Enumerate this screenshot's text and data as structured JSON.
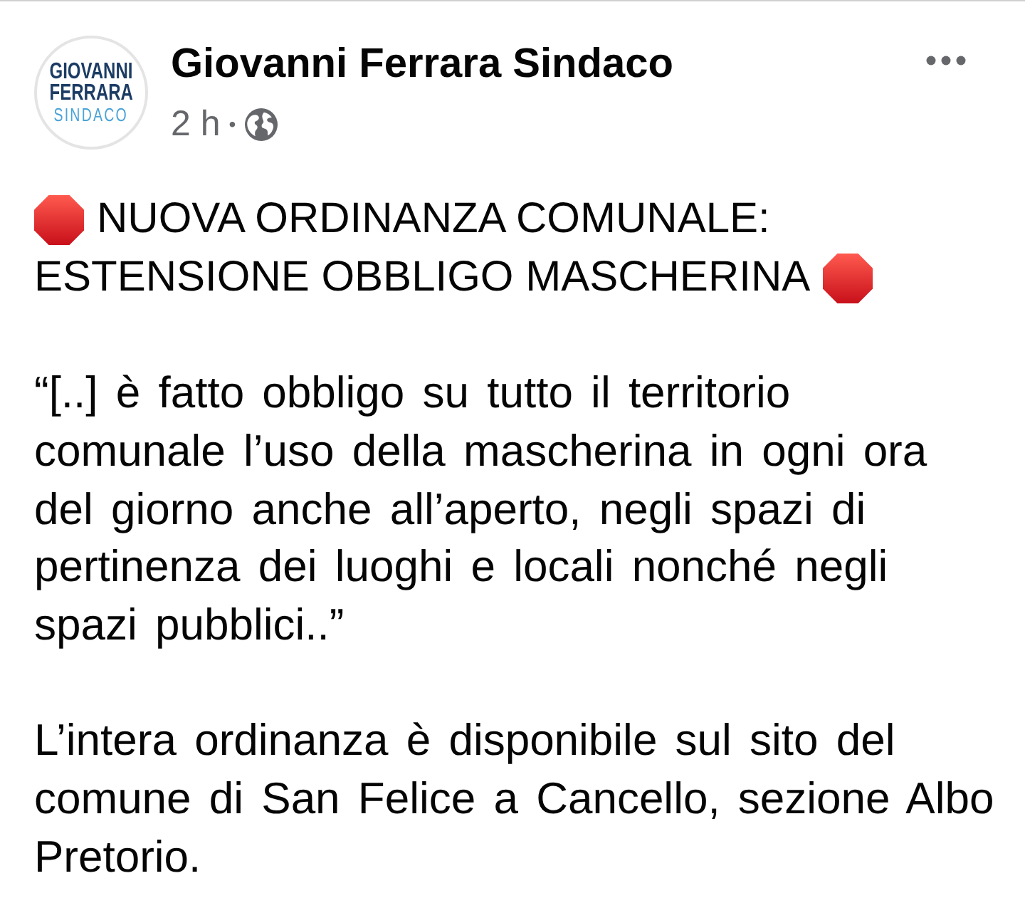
{
  "post": {
    "author": {
      "name": "Giovanni Ferrara Sindaco",
      "avatar_lines": [
        "GIOVANNI",
        "FERRARA",
        "SINDACO"
      ]
    },
    "time": "2 h",
    "separator": "•",
    "paragraphs": [
      {
        "kind": "heading",
        "lines": [
          "NUOVA ORDINANZA COMUNALE:",
          "ESTENSIONE OBBLIGO MASCHERINA"
        ]
      },
      {
        "kind": "text",
        "text": "“[..] è fatto obbligo su tutto il territorio comunale l’uso della mascherina in ogni ora del giorno anche all’aperto, negli spazi di pertinenza dei luoghi e locali nonché negli spazi pubblici..”"
      },
      {
        "kind": "text",
        "text": "L’intera ordinanza è disponibile sul sito del comune di San Felice a Cancello, sezione Albo Pretorio."
      }
    ]
  }
}
